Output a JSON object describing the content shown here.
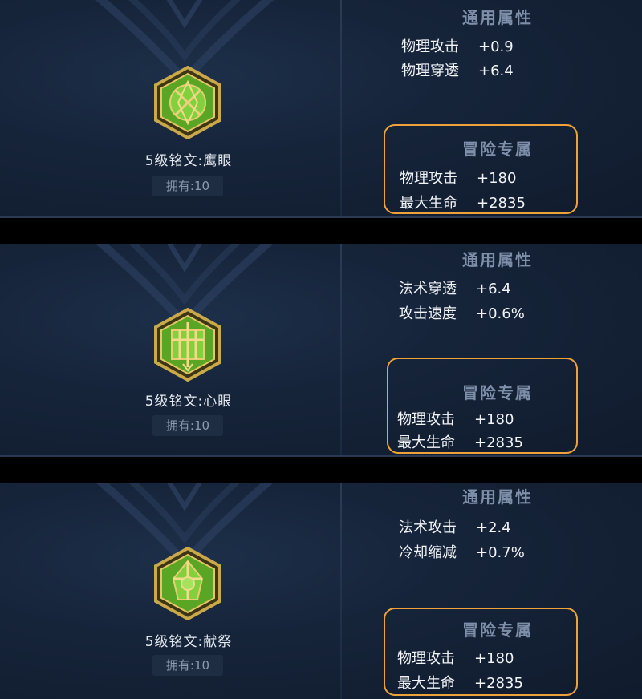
{
  "panels": [
    {
      "rune_name": "5级铭文:鹰眼",
      "owned": "拥有:10",
      "general_title": "通用属性",
      "general_stats": [
        {
          "name": "物理攻击",
          "value": "+0.9"
        },
        {
          "name": "物理穿透",
          "value": "+6.4"
        }
      ],
      "adventure_title": "冒险专属",
      "adventure_stats": [
        {
          "name": "物理攻击",
          "value": "+180"
        },
        {
          "name": "最大生命",
          "value": "+2835"
        }
      ],
      "gem_icon": "hawk-eye-rune-icon"
    },
    {
      "rune_name": "5级铭文:心眼",
      "owned": "拥有:10",
      "general_title": "通用属性",
      "general_stats": [
        {
          "name": "法术穿透",
          "value": "+6.4"
        },
        {
          "name": "攻击速度",
          "value": "+0.6%"
        }
      ],
      "adventure_title": "冒险专属",
      "adventure_stats": [
        {
          "name": "物理攻击",
          "value": "+180"
        },
        {
          "name": "最大生命",
          "value": "+2835"
        }
      ],
      "gem_icon": "mind-eye-rune-icon"
    },
    {
      "rune_name": "5级铭文:献祭",
      "owned": "拥有:10",
      "general_title": "通用属性",
      "general_stats": [
        {
          "name": "法术攻击",
          "value": "+2.4"
        },
        {
          "name": "冷却缩减",
          "value": "+0.7%"
        }
      ],
      "adventure_title": "冒险专属",
      "adventure_stats": [
        {
          "name": "物理攻击",
          "value": "+180"
        },
        {
          "name": "最大生命",
          "value": "+2835"
        }
      ],
      "gem_icon": "sacrifice-rune-icon"
    }
  ],
  "colors": {
    "highlight_border": "#f0a23a",
    "gem_green": "#6fbf2e",
    "gem_gold": "#c9a94a"
  }
}
